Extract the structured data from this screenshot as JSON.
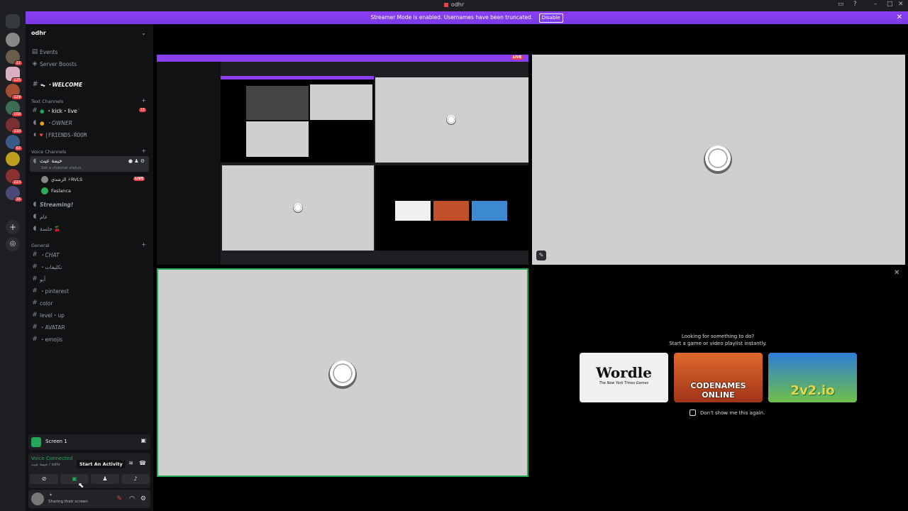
{
  "window": {
    "title": "odhr"
  },
  "banner": {
    "text": "Streamer Mode is enabled. Usernames have been truncated.",
    "disable_label": "Disable"
  },
  "server": {
    "name": "odhr"
  },
  "rail_badges": [
    "12",
    "125",
    "129",
    "160",
    "110",
    "62",
    "223",
    "18"
  ],
  "nav": {
    "events": "Events",
    "boosts": "Server Boosts",
    "welcome": "ᯓ ・WELCOME"
  },
  "categories": {
    "text": "Text Channels",
    "voice": "Voice Channels",
    "general": "General"
  },
  "text_channels": [
    {
      "name": "・kick・live",
      "badge": "12"
    },
    {
      "name": "・OWNER"
    },
    {
      "name": "|FRIENDS-ROOM"
    }
  ],
  "voice": {
    "active_channel": "خيمة عيث",
    "status_placeholder": "Set a channel status",
    "users": [
      {
        "name": "الرشدي ⚡RVLS",
        "live": "LIVE"
      },
      {
        "name": "Faslanca"
      }
    ],
    "other_channels": [
      "Streaming!",
      "عام",
      "جلسة 🍒"
    ]
  },
  "general_channels": [
    "・CHAT",
    "・تكليفات",
    "أبو",
    "・pinterest",
    "color",
    "level・up",
    "・AVATAR",
    "・emojis"
  ],
  "panel": {
    "screen_label": "Screen 1",
    "voice_connected": "Voice Connected",
    "voice_sub": "خيمة عيث / odhr",
    "tooltip": "Start An Activity",
    "user_status": "Sharing their screen"
  },
  "stage": {
    "activity_line1": "Looking for something to do?",
    "activity_line2": "Start a game or video playlist instantly.",
    "cards": [
      {
        "title": "Wordle",
        "subtitle": "The New York Times Games"
      },
      {
        "title": "CODENAMES ONLINE"
      },
      {
        "title": "2v2.io"
      }
    ],
    "dont_show": "Don't show me this again.",
    "live_badge": "LIVE"
  }
}
